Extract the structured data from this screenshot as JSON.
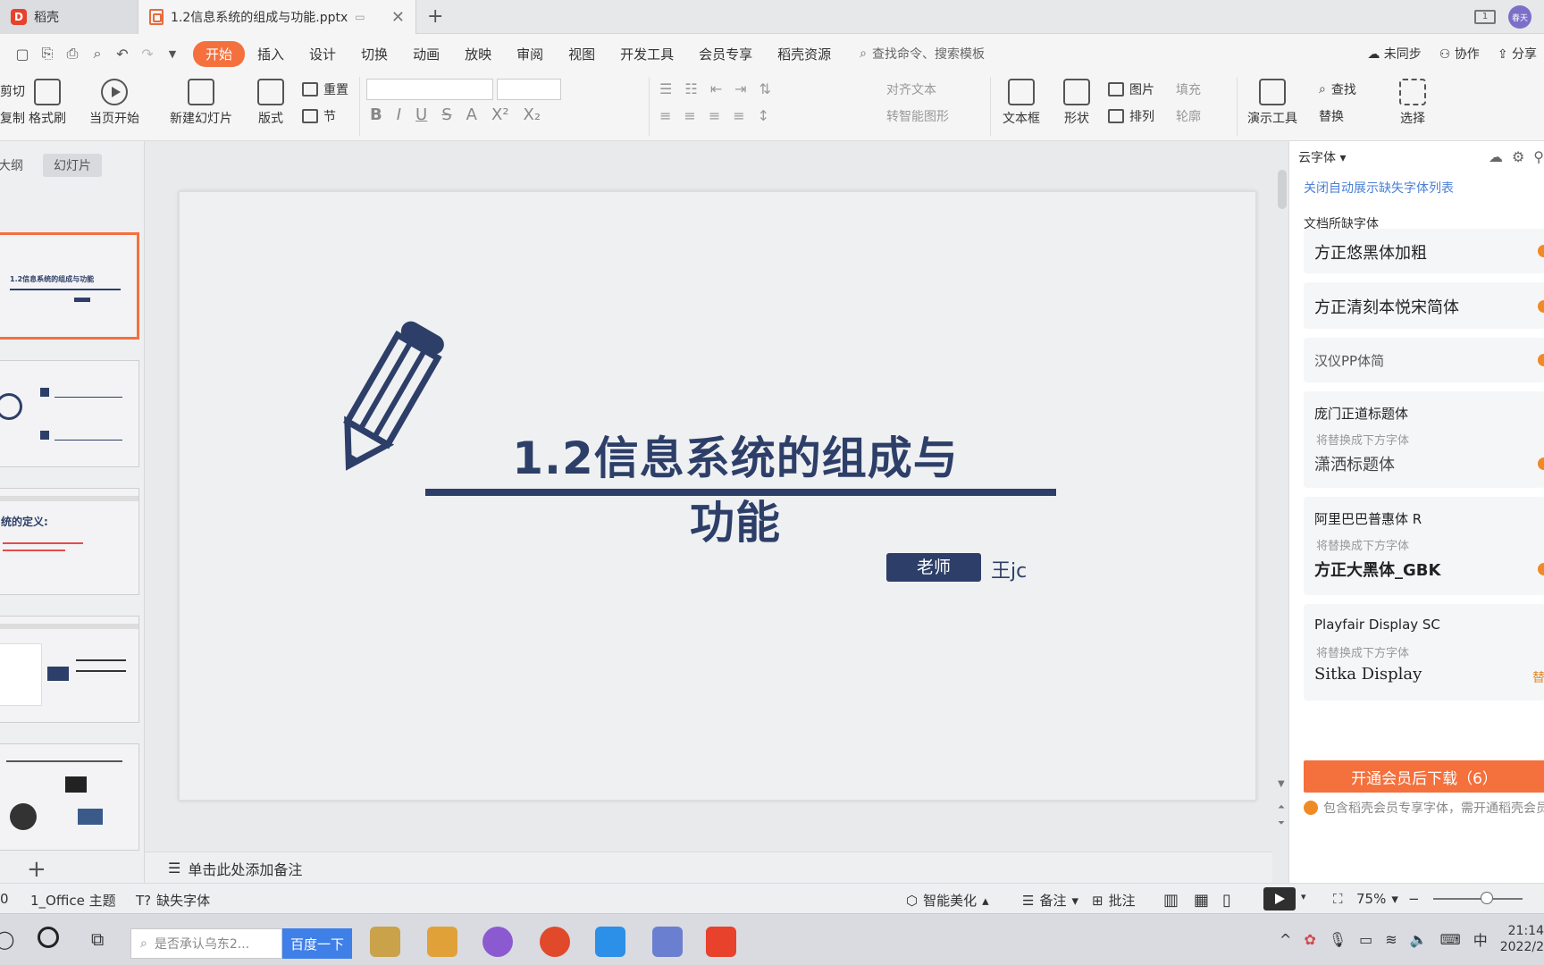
{
  "titlebar": {
    "home_tab": "稻壳",
    "doc_tab": "1.2信息系统的组成与功能.pptx",
    "avatar_text": "春天",
    "window_count": "1"
  },
  "menu": {
    "items": [
      "开始",
      "插入",
      "设计",
      "切换",
      "动画",
      "放映",
      "审阅",
      "视图",
      "开发工具",
      "会员专享",
      "稻壳资源"
    ],
    "active": "开始",
    "search": "查找命令、搜索模板",
    "sync": "未同步",
    "collab": "协作",
    "share": "分享"
  },
  "ribbon": {
    "cut": "剪切",
    "copy": "复制",
    "format_painter": "格式刷",
    "from_current": "当页开始",
    "new_slide": "新建幻灯片",
    "layout": "版式",
    "reset": "重置",
    "section": "节",
    "align_text": "对齐文本",
    "to_smartart": "转智能图形",
    "textbox": "文本框",
    "shape": "形状",
    "picture": "图片",
    "arrange": "排列",
    "fill": "填充",
    "outline": "轮廓",
    "present_tools": "演示工具",
    "find": "查找",
    "replace": "替换",
    "select": "选择"
  },
  "left_panel": {
    "tab_outline": "大纲",
    "tab_slides": "幻灯片",
    "thumb1_title": "1.2信息系统的组成与功能",
    "thumb3_title": "统的定义:"
  },
  "slide": {
    "title": "1.2信息系统的组成与功能",
    "badge": "老师",
    "name": "王jc"
  },
  "notes": {
    "placeholder": "单击此处添加备注"
  },
  "right_panel": {
    "header": "云字体",
    "link": "关闭自动展示缺失字体列表",
    "subtitle": "文档所缺字体",
    "replace_hint": "将替换成下方字体",
    "fonts": [
      {
        "name": "方正悠黑体加粗"
      },
      {
        "name": "方正清刻本悦宋简体"
      },
      {
        "name": "汉仪PP体简"
      },
      {
        "name": "庞门正道标题体",
        "replacement": "潇洒标题体"
      },
      {
        "name": "阿里巴巴普惠体 R",
        "replacement": "方正大黑体_GBK"
      },
      {
        "name": "Playfair Display SC",
        "replacement": "Sitka Display",
        "action": "替换"
      }
    ],
    "download_button": "开通会员后下载（6）",
    "note": "包含稻壳会员专享字体，需开通稻壳会员"
  },
  "statusbar": {
    "slide_num": "0",
    "theme": "1_Office 主题",
    "missing_fonts": "缺失字体",
    "beautify": "智能美化",
    "notes": "备注",
    "comments": "批注",
    "zoom": "75%"
  },
  "taskbar": {
    "search_placeholder": "是否承认乌东2...",
    "search_button": "百度一下",
    "ime": "中",
    "time": "21:14",
    "date": "2022/2"
  },
  "colors": {
    "accent": "#f4703d",
    "slide_navy": "#2d3f68",
    "link_blue": "#4a7fd6"
  }
}
